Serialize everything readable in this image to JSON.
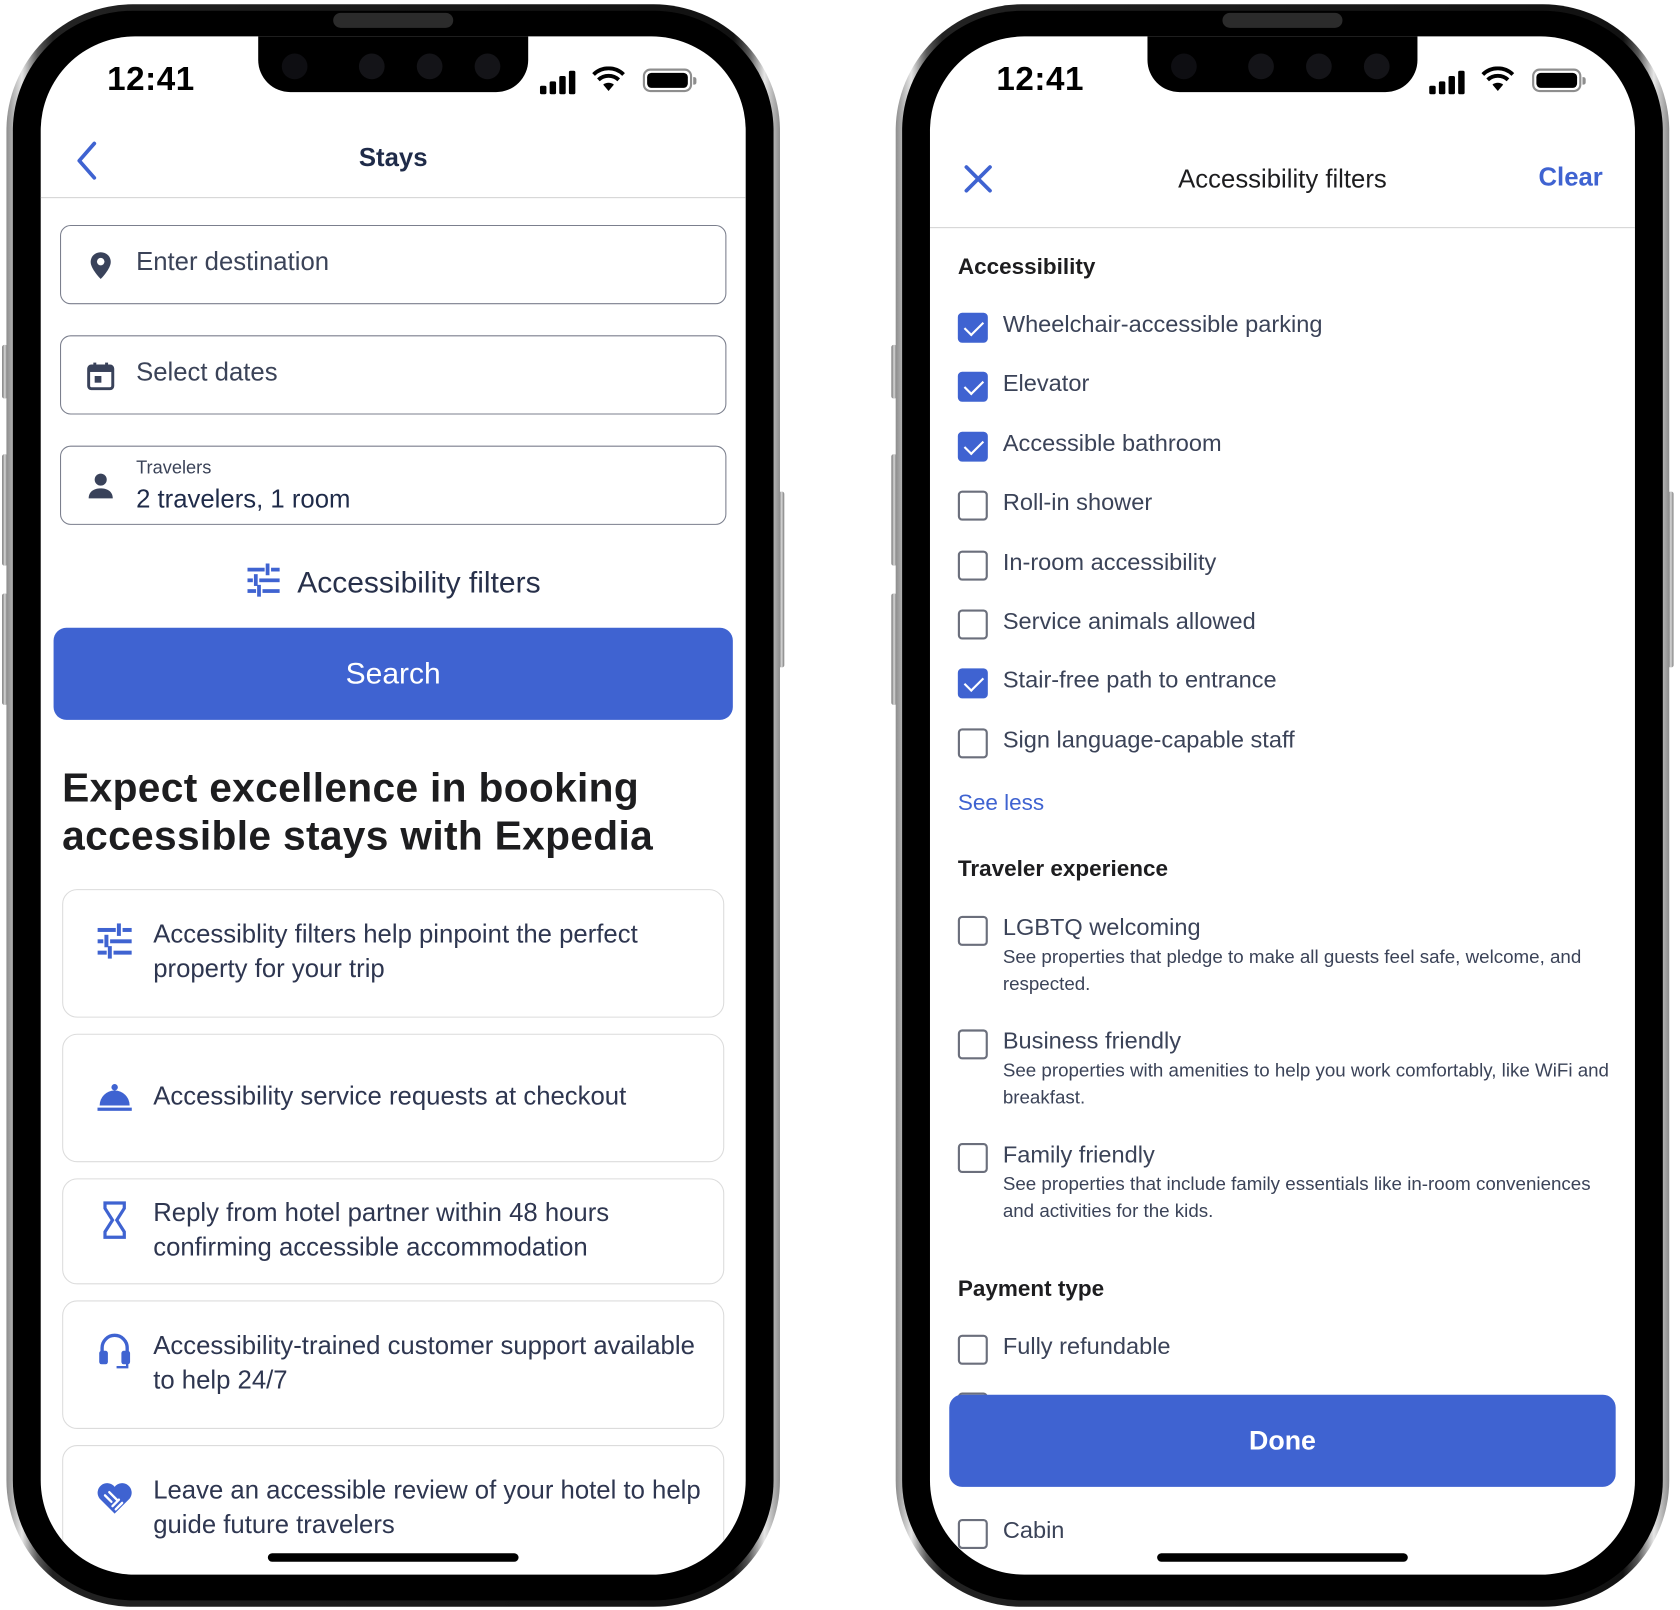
{
  "status_bar": {
    "time": "12:41"
  },
  "left_screen": {
    "nav": {
      "title": "Stays",
      "back_icon": "chevron-left-icon"
    },
    "fields": {
      "destination": {
        "placeholder": "Enter destination",
        "icon": "map-pin-icon"
      },
      "dates": {
        "placeholder": "Select dates",
        "icon": "calendar-icon"
      },
      "travelers": {
        "label": "Travelers",
        "value": "2 travelers, 1 room",
        "icon": "person-icon"
      }
    },
    "filters_link": {
      "label": "Accessibility filters",
      "icon": "sliders-icon"
    },
    "search_button": {
      "label": "Search"
    },
    "hero": {
      "line1": "Expect excellence in booking",
      "line2": "accessible stays with Expedia"
    },
    "features": [
      {
        "icon": "sliders-icon",
        "text": "Accessiblity filters help pinpoint the perfect property for your trip"
      },
      {
        "icon": "service-bell-icon",
        "text": "Accessibility service requests at checkout"
      },
      {
        "icon": "hourglass-icon",
        "text": "Reply from hotel partner within 48 hours confirming accessible accommodation"
      },
      {
        "icon": "headset-icon",
        "text": "Accessibility-trained customer support available to help 24/7"
      },
      {
        "icon": "handshake-heart-icon",
        "text": "Leave an accessible review of your hotel to help guide future travelers"
      }
    ]
  },
  "right_screen": {
    "nav": {
      "title": "Accessibility filters",
      "close_icon": "close-icon",
      "clear_label": "Clear"
    },
    "sections": {
      "accessibility": {
        "title": "Accessibility",
        "options": [
          {
            "label": "Wheelchair-accessible parking",
            "checked": true
          },
          {
            "label": "Elevator",
            "checked": true
          },
          {
            "label": "Accessible bathroom",
            "checked": true
          },
          {
            "label": "Roll-in shower",
            "checked": false
          },
          {
            "label": "In-room accessibility",
            "checked": false
          },
          {
            "label": "Service animals allowed",
            "checked": false
          },
          {
            "label": "Stair-free path to entrance",
            "checked": true
          },
          {
            "label": "Sign language-capable staff",
            "checked": false
          }
        ],
        "see_less": "See less"
      },
      "traveler_experience": {
        "title": "Traveler experience",
        "options": [
          {
            "label": "LGBTQ welcoming",
            "description": "See properties that pledge to make all guests feel safe, welcome, and respected.",
            "checked": false
          },
          {
            "label": "Business friendly",
            "description": "See properties with amenities to help you work comfortably, like WiFi and breakfast.",
            "checked": false
          },
          {
            "label": "Family friendly",
            "description": "See properties that include family essentials like in-room conveniences and activities for the kids.",
            "checked": false
          }
        ]
      },
      "payment_type": {
        "title": "Payment type",
        "options": [
          {
            "label": "Fully refundable",
            "checked": false
          }
        ]
      },
      "property_type_partial": {
        "options": [
          {
            "label": "Cabin",
            "checked": false
          }
        ]
      }
    },
    "done_button": {
      "label": "Done"
    }
  },
  "colors": {
    "accent": "#3f63d1",
    "text_primary": "#1f2b49",
    "border": "#7b7f8d"
  }
}
